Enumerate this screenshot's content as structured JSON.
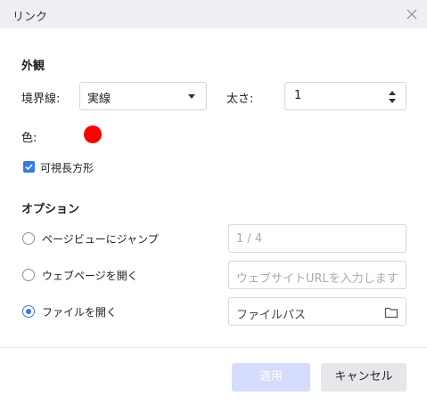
{
  "dialog": {
    "title": "リンク"
  },
  "appearance": {
    "section_title": "外観",
    "border_label": "境界線:",
    "border_value": "実線",
    "thickness_label": "太さ:",
    "thickness_value": "1",
    "color_label": "色:",
    "color_value": "#ff0000",
    "visible_rect_label": "可視長方形",
    "visible_rect_checked": true
  },
  "options": {
    "section_title": "オプション",
    "jump_label": "ページビューにジャンプ",
    "jump_placeholder": "1 / 4",
    "open_web_label": "ウェブページを開く",
    "open_web_placeholder": "ウェブサイトURLを入力します",
    "open_file_label": "ファイルを開く",
    "open_file_value": "ファイルパス",
    "selected": "open_file"
  },
  "footer": {
    "apply_label": "適用",
    "cancel_label": "キャンセル"
  },
  "colors": {
    "accent": "#3b78e7",
    "apply_disabled_bg": "#d4dbfb",
    "titlebar_bg": "#eeeff3"
  }
}
